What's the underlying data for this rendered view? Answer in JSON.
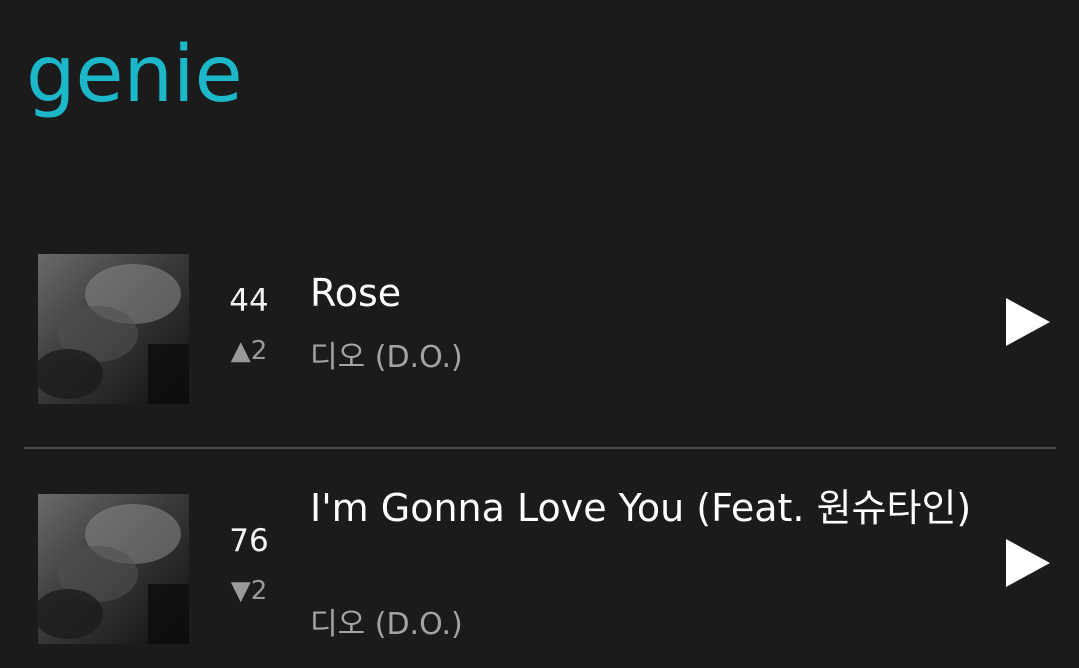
{
  "app": {
    "logo_text": "genie",
    "brand_color": "#1cb8c9"
  },
  "tracks": [
    {
      "rank": "44",
      "change_direction": "up",
      "change_arrow": "▲",
      "change_value": "2",
      "title": "Rose",
      "artist": "디오 (D.O.)",
      "play_icon": "play-icon"
    },
    {
      "rank": "76",
      "change_direction": "down",
      "change_arrow": "▼",
      "change_value": "2",
      "title": "I'm Gonna Love You (Feat. 원슈타인)",
      "artist": "디오 (D.O.)",
      "play_icon": "play-icon"
    }
  ]
}
